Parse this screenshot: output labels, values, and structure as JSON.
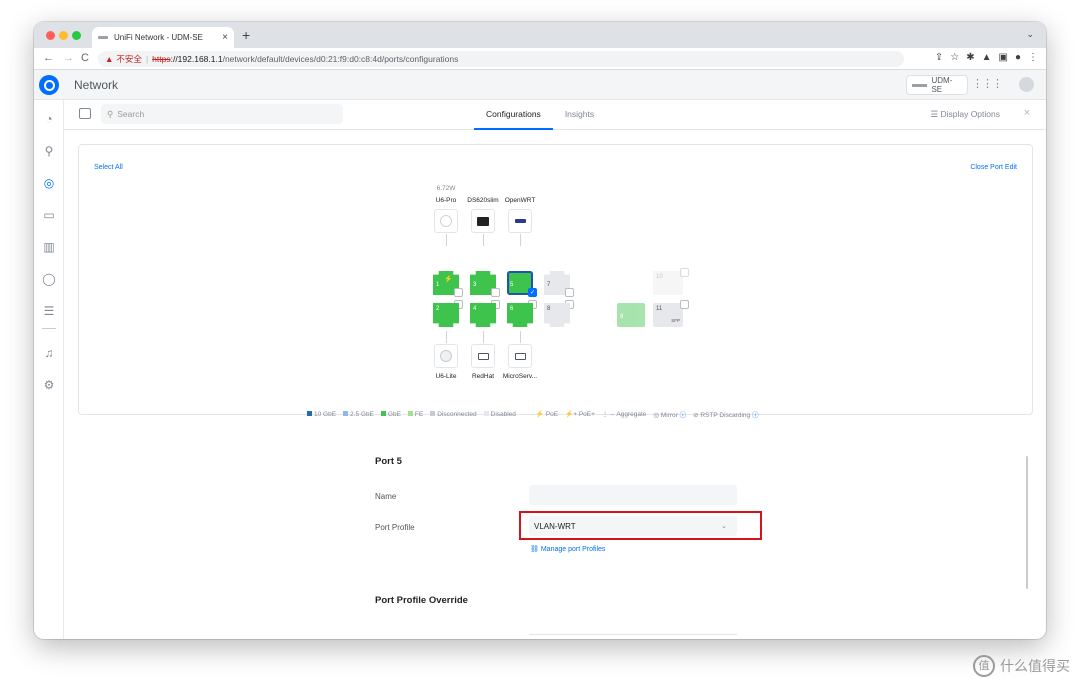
{
  "browser": {
    "tab_title": "UniFi Network - UDM-SE",
    "tab_close": "×",
    "new_tab": "+",
    "tab_menu": "⌄",
    "nav_back": "←",
    "nav_forward": "→",
    "nav_reload": "C",
    "insecure_icon": "▲",
    "insecure_label": "不安全",
    "url_scheme": "https",
    "url_host": "://192.168.1.1",
    "url_path": "/network/default/devices/d0:21:f9:d0:c8:4d/ports/configurations",
    "toolbar_icons": [
      "share-icon",
      "star-icon",
      "extensions-icon",
      "flask-icon",
      "sidebar-icon",
      "profile-icon",
      "more-icon"
    ]
  },
  "app": {
    "title": "Network",
    "device_name": "UDM-SE"
  },
  "rail": {
    "icons": [
      "dashboard-icon",
      "topology-icon",
      "devices-icon",
      "client-devices-icon",
      "statistics-icon",
      "insights-icon",
      "logs-icon",
      "alarm-icon",
      "settings-icon"
    ],
    "active": "devices-icon"
  },
  "subheader": {
    "search_placeholder": "Search",
    "tabs": [
      "Configurations",
      "Insights"
    ],
    "active_tab": "Configurations",
    "display_options": "Display Options",
    "close": "×"
  },
  "switch_panel": {
    "select_all": "Select All",
    "close_port_edit": "Close Port Edit",
    "top_devices": [
      {
        "power": "6.72W",
        "name": "U6-Pro",
        "icon": "access-point-icon"
      },
      {
        "power": "",
        "name": "DS620slim",
        "icon": "nas-icon"
      },
      {
        "power": "",
        "name": "OpenWRT",
        "icon": "router-icon"
      }
    ],
    "bottom_devices": [
      {
        "name": "U6-Lite",
        "icon": "access-point-icon"
      },
      {
        "name": "RedHat",
        "icon": "server-icon"
      },
      {
        "name": "MicroServ...",
        "icon": "server-icon"
      }
    ],
    "ports": [
      {
        "num": "1",
        "state": "GbE",
        "poe": true
      },
      {
        "num": "2",
        "state": "GbE",
        "poe": false
      },
      {
        "num": "3",
        "state": "GbE",
        "poe": false
      },
      {
        "num": "4",
        "state": "GbE",
        "poe": false
      },
      {
        "num": "5",
        "state": "GbE",
        "poe": false,
        "selected": true
      },
      {
        "num": "6",
        "state": "GbE",
        "poe": false
      },
      {
        "num": "7",
        "state": "Disconnected",
        "poe": false
      },
      {
        "num": "8",
        "state": "Disconnected",
        "poe": false
      },
      {
        "num": "9",
        "state": "GbE",
        "poe": false,
        "faded": true
      },
      {
        "num": "10",
        "state": "Disabled",
        "poe": false
      },
      {
        "num": "11",
        "state": "Disconnected",
        "poe": false,
        "sfp": "SFP"
      }
    ],
    "legend": [
      {
        "label": "10 GbE",
        "color": "#1f6fb0"
      },
      {
        "label": "2.5 GbE",
        "color": "#8fb9e8"
      },
      {
        "label": "GbE",
        "color": "#3ec44c"
      },
      {
        "label": "FE",
        "color": "#a6e08a"
      },
      {
        "label": "Disconnected",
        "color": "#c7ccd1"
      },
      {
        "label": "Disabled",
        "color": "#e6e8eb"
      }
    ],
    "legend_extra": [
      {
        "icon": "⚡",
        "label": "PoE"
      },
      {
        "icon": "⚡+",
        "label": "PoE+"
      },
      {
        "icon": "⋮→",
        "label": "Aggregate"
      },
      {
        "icon": "◎",
        "label": "Mirror"
      },
      {
        "icon": "⊘",
        "label": "RSTP Discarding"
      }
    ]
  },
  "port_form": {
    "title": "Port 5",
    "name_label": "Name",
    "name_value": "",
    "profile_label": "Port Profile",
    "profile_value": "VLAN-WRT",
    "manage_link": "Manage port Profiles",
    "override_title": "Port Profile Override"
  },
  "watermark": {
    "seal": "值",
    "text": "什么值得买"
  },
  "colors": {
    "accent": "#006fff",
    "port_green": "#3ec44c",
    "highlight_box": "#d4141b"
  }
}
